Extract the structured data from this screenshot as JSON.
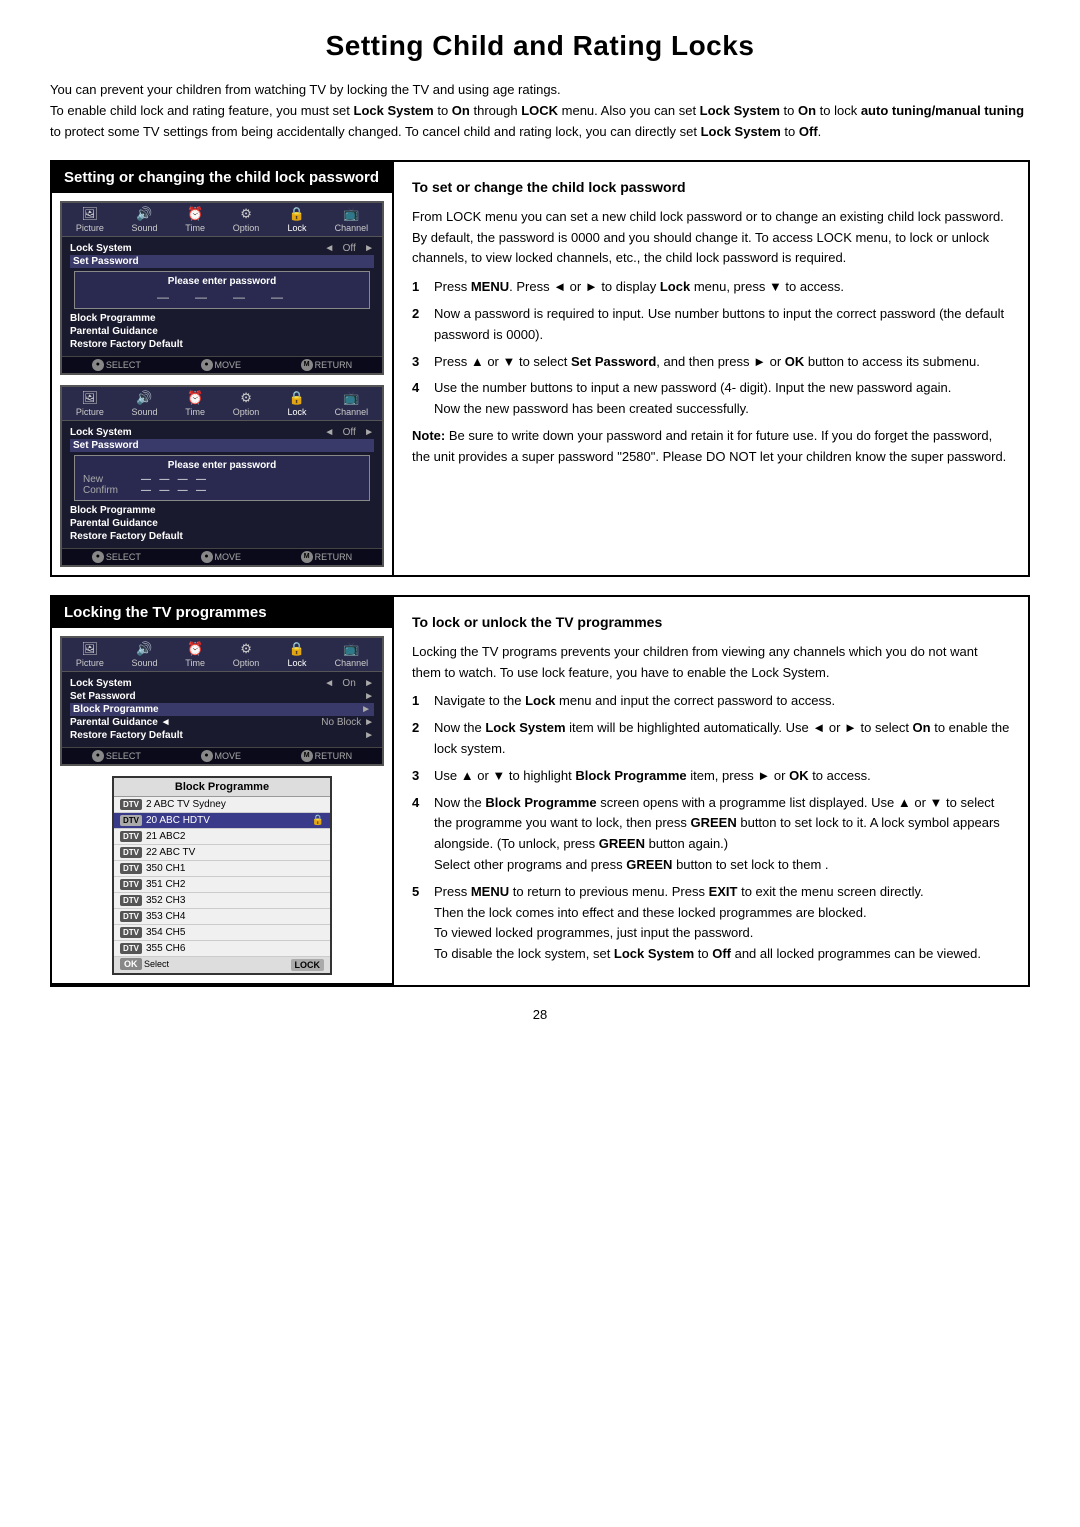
{
  "page": {
    "title": "Setting Child and Rating Locks",
    "page_number": "28"
  },
  "intro": {
    "line1": "You can prevent your children from watching TV by locking the TV and using age ratings.",
    "line2": "To enable child lock and rating feature, you must set Lock System to On through LOCK menu. Also you can set Lock System to On to lock auto tuning/manual tuning to protect some TV settings from being accidentally changed. To cancel child and rating lock, you can directly set Lock System to Off."
  },
  "section1": {
    "header": "Setting or changing the child lock password",
    "right_title": "To set or change the child lock password",
    "right_para": "From LOCK menu you can set a new child lock password or to change an existing child lock password. By default, the password is 0000 and you should change it. To access LOCK menu, to lock or unlock channels, to view locked channels, etc., the child lock password is required.",
    "steps": [
      {
        "num": "1",
        "text": "Press MENU. Press ◄ or ► to display Lock menu, press ▼ to access."
      },
      {
        "num": "2",
        "text": "Now a password is required to input. Use number buttons to input the correct password (the default password is 0000)."
      },
      {
        "num": "3",
        "text": "Press ▲ or ▼ to select Set Password, and then press ► or OK button to access its submenu."
      },
      {
        "num": "4",
        "text": "Use the number buttons to input a new password (4- digit). Input the new password again. Now the new password has been created successfully."
      }
    ],
    "note": "Note: Be sure to write down your password and retain it for future use. If you do forget the password, the unit provides a super password \"2580\". Please DO NOT let your children know the super password.",
    "screens": [
      {
        "menu_items": [
          "Picture",
          "Sound",
          "Time",
          "Option",
          "Lock",
          "Channel"
        ],
        "active_item": "Lock",
        "rows": [
          {
            "label": "Lock System",
            "val": "Off",
            "selected": false
          },
          {
            "label": "Set Password",
            "val": "",
            "selected": true
          },
          {
            "label": "Block Programme",
            "val": "",
            "selected": false
          },
          {
            "label": "Parental Guidance",
            "val": "",
            "selected": false
          },
          {
            "label": "Restore Factory Default",
            "val": "",
            "selected": false
          }
        ],
        "popup": {
          "show": true,
          "title": "Please enter password",
          "dashes": "— — — —",
          "rows": []
        }
      },
      {
        "menu_items": [
          "Picture",
          "Sound",
          "Time",
          "Option",
          "Lock",
          "Channel"
        ],
        "active_item": "Lock",
        "rows": [
          {
            "label": "Lock System",
            "val": "Off",
            "selected": false
          },
          {
            "label": "Set Password",
            "val": "",
            "selected": true
          },
          {
            "label": "Block Programme",
            "val": "",
            "selected": false
          },
          {
            "label": "Parental Guidance",
            "val": "",
            "selected": false
          },
          {
            "label": "Restore Factory Default",
            "val": "",
            "selected": false
          }
        ],
        "popup": {
          "show": true,
          "title": "Please enter password",
          "dashes": "",
          "rows": [
            {
              "label": "New",
              "val": "— — — —"
            },
            {
              "label": "Confirm",
              "val": "— — — —"
            }
          ]
        }
      }
    ]
  },
  "section2": {
    "header": "Locking the TV programmes",
    "right_title": "To lock or unlock the TV programmes",
    "right_para": "Locking the TV programs prevents your children from viewing any channels which you do not want them to watch. To use lock feature, you have to enable the Lock System.",
    "steps": [
      {
        "num": "1",
        "text": "Navigate to the Lock menu and input the correct password to access."
      },
      {
        "num": "2",
        "text": "Now the Lock System item will be highlighted automatically. Use ◄ or ► to select On to enable the lock system."
      },
      {
        "num": "3",
        "text": "Use ▲ or ▼ to highlight Block Programme item, press ► or OK to access."
      },
      {
        "num": "4",
        "text": "Now the Block Programme screen opens with a programme list displayed. Use ▲ or ▼ to select the programme you want to lock, then press GREEN button to set lock to it. A lock symbol appears alongside. (To unlock, press GREEN button again.) Select other programs and press GREEN button to set lock to them ."
      },
      {
        "num": "5",
        "text": "Press MENU to return to previous menu. Press EXIT to exit the menu screen directly. Then the lock comes into effect and these locked programmes are blocked. To viewed locked programmes, just input the password. To disable the lock system, set Lock System to Off and all locked programmes can be viewed."
      }
    ],
    "main_screen": {
      "menu_items": [
        "Picture",
        "Sound",
        "Time",
        "Option",
        "Lock",
        "Channel"
      ],
      "active_item": "Lock",
      "rows": [
        {
          "label": "Lock System",
          "left_arrow": true,
          "val": "On",
          "right_arrow": true,
          "selected": false
        },
        {
          "label": "Set Password",
          "val": "",
          "right_arrow": true,
          "selected": false
        },
        {
          "label": "Block Programme",
          "val": "",
          "right_arrow": true,
          "selected": false
        },
        {
          "label": "Parental Guidance",
          "left_arrow": true,
          "val": "No Block",
          "right_arrow": true,
          "selected": false
        },
        {
          "label": "Restore Factory Default",
          "val": "",
          "right_arrow": true,
          "selected": false
        }
      ]
    },
    "block_prog": {
      "title": "Block Programme",
      "items": [
        {
          "badge": "DTV",
          "name": "2 ABC TV Sydney",
          "locked": false
        },
        {
          "badge": "DTV",
          "name": "20 ABC HDTV",
          "locked": true,
          "selected": true
        },
        {
          "badge": "DTV",
          "name": "21 ABC2",
          "locked": false
        },
        {
          "badge": "DTV",
          "name": "22 ABC TV",
          "locked": false
        },
        {
          "badge": "DTV",
          "name": "350 CH1",
          "locked": false
        },
        {
          "badge": "DTV",
          "name": "351 CH2",
          "locked": false
        },
        {
          "badge": "DTV",
          "name": "352 CH3",
          "locked": false
        },
        {
          "badge": "DTV",
          "name": "353 CH4",
          "locked": false
        },
        {
          "badge": "DTV",
          "name": "354 CH5",
          "locked": false
        },
        {
          "badge": "DTV",
          "name": "355 CH6",
          "locked": false
        }
      ],
      "footer_ok": "OK  Select",
      "footer_lock": "LOCK"
    }
  },
  "menu_icons": {
    "Picture": "🖼",
    "Sound": "🔊",
    "Time": "⏰",
    "Option": "⚙",
    "Lock": "🔒",
    "Channel": "📺"
  }
}
